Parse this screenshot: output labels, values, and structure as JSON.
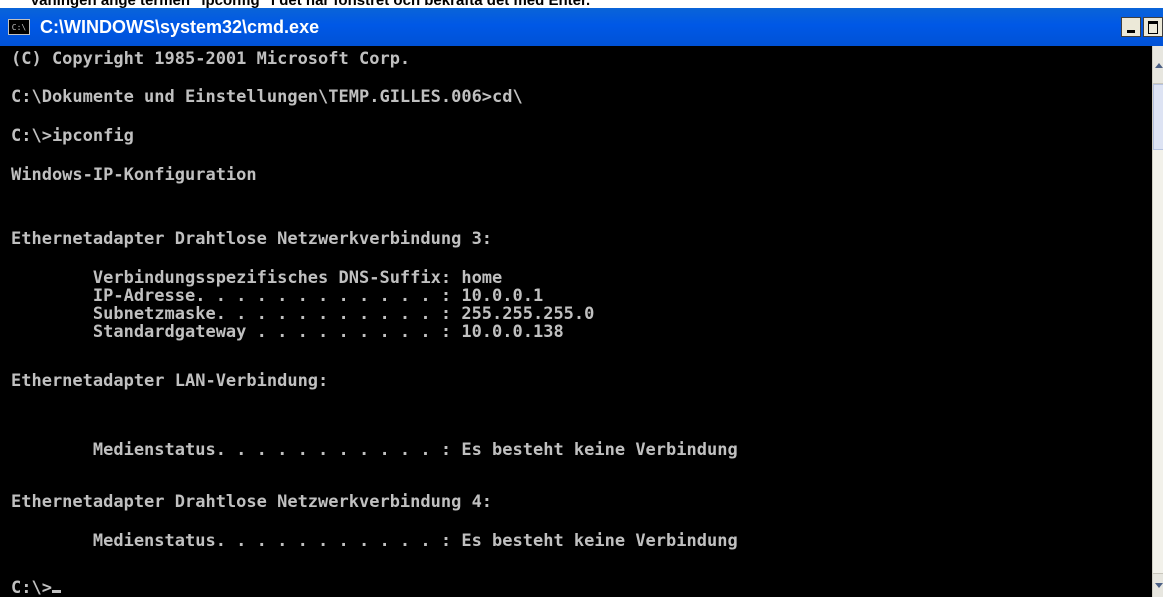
{
  "caption": "Vaningen ange termen \"ipconfig\" i det nar fonstret och bekrafta det med Enter.",
  "window": {
    "title": "C:\\WINDOWS\\system32\\cmd.exe",
    "icon": "cmd-console-icon",
    "icon_text": "C:\\",
    "controls": {
      "minimize": "minimize-icon",
      "maximize": "maximize-icon"
    }
  },
  "console": {
    "text_color": "#c0c0c0",
    "background": "#000000",
    "lines": [
      "(C) Copyright 1985-2001 Microsoft Corp.",
      "C:\\Dokumente und Einstellungen\\TEMP.GILLES.006>cd\\",
      "C:\\>ipconfig",
      "Windows-IP-Konfiguration",
      "Ethernetadapter Drahtlose Netzwerkverbindung 3:",
      "        Verbindungsspezifisches DNS-Suffix: home",
      "        IP-Adresse. . . . . . . . . . . . : 10.0.0.1",
      "        Subnetzmaske. . . . . . . . . . . : 255.255.255.0",
      "        Standardgateway . . . . . . . . . : 10.0.0.138",
      "Ethernetadapter LAN-Verbindung:",
      "        Medienstatus. . . . . . . . . . . : Es besteht keine Verbindung",
      "Ethernetadapter Drahtlose Netzwerkverbindung 4:",
      "        Medienstatus. . . . . . . . . . . : Es besteht keine Verbindung",
      "C:\\>"
    ]
  },
  "colors": {
    "titlebar": "#0058e6",
    "title_text": "#ffffff"
  }
}
